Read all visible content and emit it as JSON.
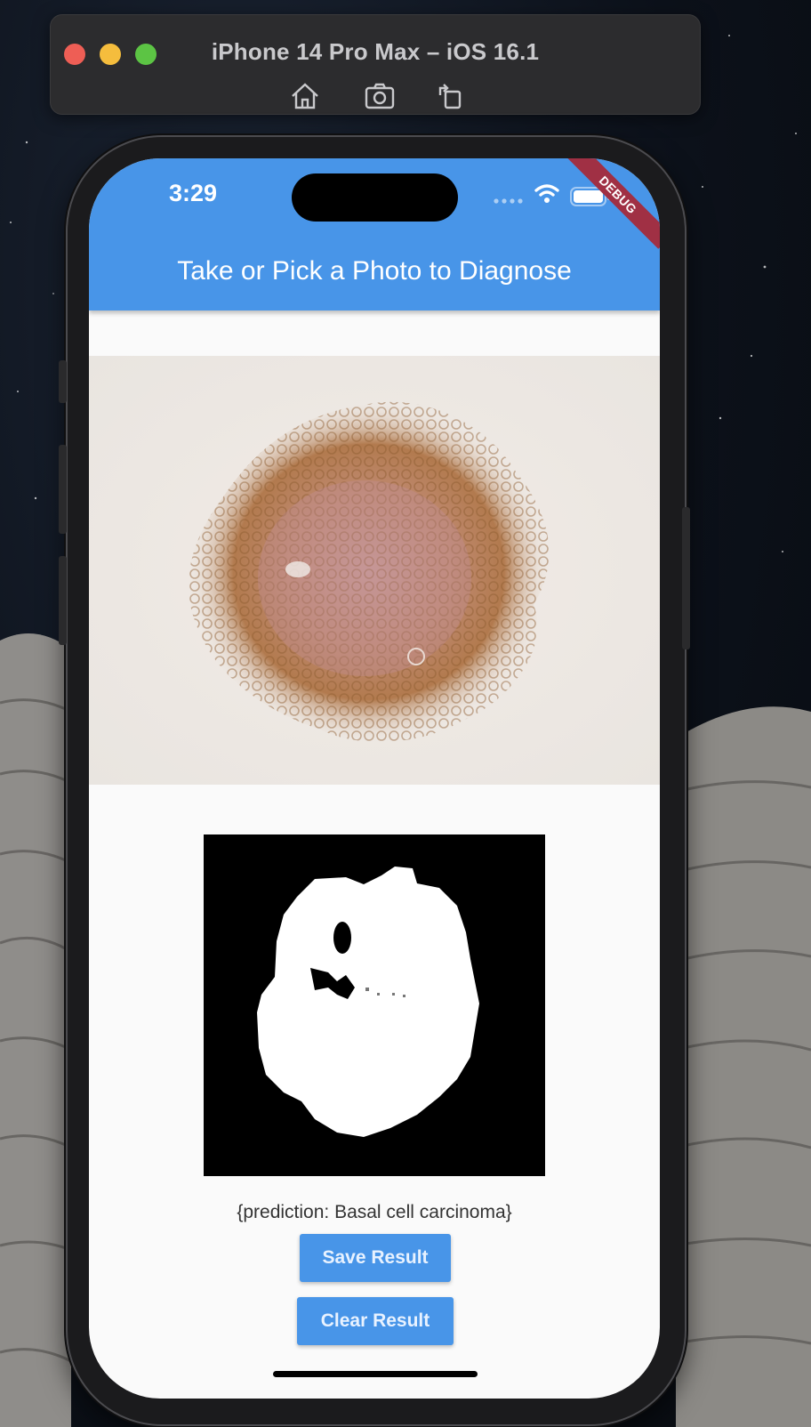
{
  "simulator": {
    "title": "iPhone 14 Pro Max – iOS 16.1",
    "toolbar": [
      "home-icon",
      "screenshot-icon",
      "rotate-icon"
    ]
  },
  "status_bar": {
    "time": "3:29",
    "debug_banner": "DEBUG"
  },
  "app_bar": {
    "title": "Take or Pick a Photo to Diagnose",
    "color": "#4895e8"
  },
  "content": {
    "photo": "dermoscopy-lesion-image",
    "mask": "segmentation-mask-image",
    "prediction": "{prediction: Basal cell carcinoma}"
  },
  "buttons": {
    "save_label": "Save Result",
    "clear_label": "Clear Result"
  }
}
